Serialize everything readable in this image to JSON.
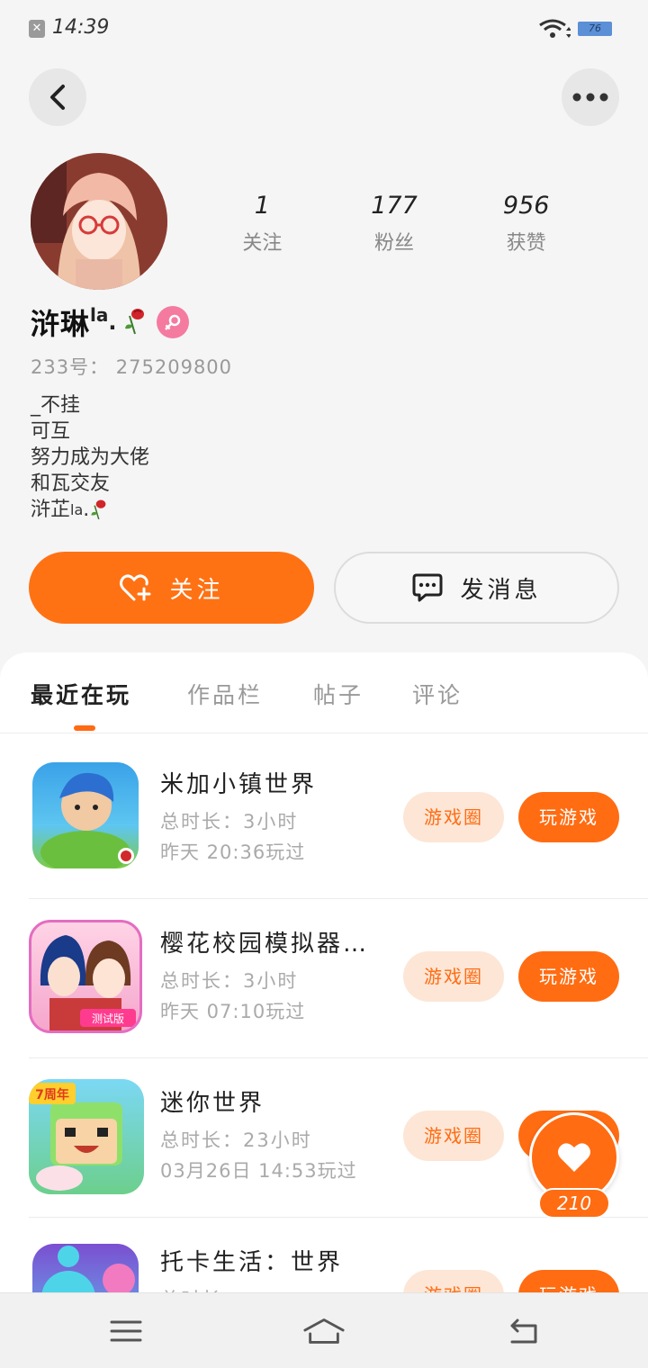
{
  "status_bar": {
    "time": "14:39",
    "battery": "76",
    "notification_icon": "x-icon"
  },
  "header": {
    "back_icon": "chevron-left-icon",
    "more_icon": "more-dots-icon"
  },
  "profile": {
    "stats": [
      {
        "value": "1",
        "label": "关注"
      },
      {
        "value": "177",
        "label": "粉丝"
      },
      {
        "value": "956",
        "label": "获赞"
      }
    ],
    "name": "浒琳",
    "name_suffix": "la",
    "uid_label": "233号：",
    "uid": "275209800",
    "bio_lines": [
      "_不挂",
      "可互",
      "努力成为大佬",
      "和瓦交友"
    ],
    "bio_last_line": "浒芷",
    "bio_last_suffix": "la",
    "gender": "female"
  },
  "actions": {
    "follow": "关注",
    "message": "发消息"
  },
  "tabs": [
    {
      "label": "最近在玩",
      "active": true
    },
    {
      "label": "作品栏",
      "active": false
    },
    {
      "label": "帖子",
      "active": false
    },
    {
      "label": "评论",
      "active": false
    }
  ],
  "games": [
    {
      "title": "米加小镇世界",
      "duration": "总时长：3小时",
      "last_played": "昨天 20:36玩过",
      "circle_label": "游戏圈",
      "play_label": "玩游戏"
    },
    {
      "title": "樱花校园模拟器…",
      "duration": "总时长：3小时",
      "last_played": "昨天 07:10玩过",
      "circle_label": "游戏圈",
      "play_label": "玩游戏",
      "badge": "测试版"
    },
    {
      "title": "迷你世界",
      "duration": "总时长：23小时",
      "last_played": "03月26日 14:53玩过",
      "circle_label": "游戏圈",
      "play_label": "玩游戏",
      "badge": "7周年"
    },
    {
      "title": "托卡生活：世界",
      "duration": "总时长：",
      "last_played": "",
      "circle_label": "游戏圈",
      "play_label": "玩游戏"
    }
  ],
  "like_fab": {
    "count": "210"
  },
  "colors": {
    "accent": "#ff6c12",
    "accent_light": "#fde6d6",
    "background": "#f5f5f5"
  }
}
